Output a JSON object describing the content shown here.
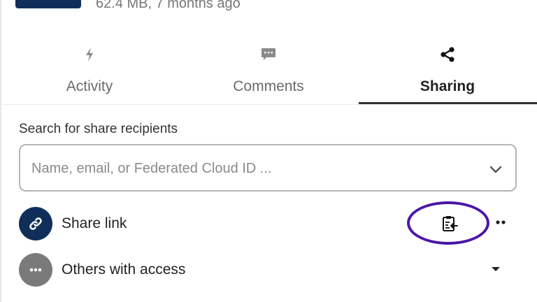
{
  "file": {
    "meta": "62.4 MB, 7 months ago"
  },
  "tabs": [
    {
      "label": "Activity",
      "icon": "lightning-icon"
    },
    {
      "label": "Comments",
      "icon": "comment-icon"
    },
    {
      "label": "Sharing",
      "icon": "share-icon",
      "active": true
    }
  ],
  "search": {
    "label": "Search for share recipients",
    "placeholder": "Name, email, or Federated Cloud ID ..."
  },
  "share_link": {
    "label": "Share link",
    "icon": "link-icon"
  },
  "others": {
    "label": "Others with access",
    "icon": "ellipsis-icon"
  },
  "colors": {
    "brand": "#0f2f5a",
    "highlight": "#4b16a8",
    "text": "#222222",
    "muted": "#6b6b6b"
  }
}
